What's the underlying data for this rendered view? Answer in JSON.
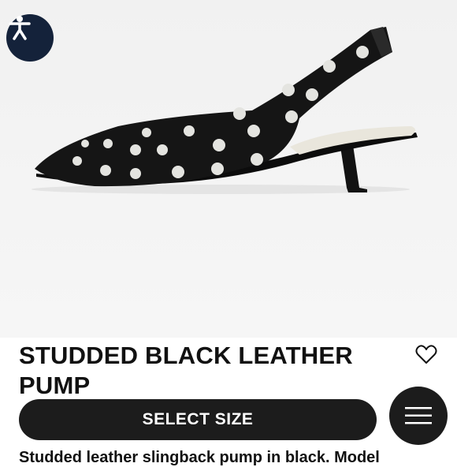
{
  "product": {
    "title": "STUDDED BLACK LEATHER PUMP",
    "description": "Studded leather slingback pump in black. Model"
  },
  "actions": {
    "select_size_label": "SELECT SIZE"
  },
  "icons": {
    "accessibility": "accessibility-icon",
    "wishlist": "heart-outline-icon",
    "menu": "hamburger-menu-icon"
  },
  "colors": {
    "button_dark": "#1c1c1c",
    "accessibility_bg": "#14223a",
    "hero_bg": "#f3f3f3",
    "text": "#111111"
  }
}
